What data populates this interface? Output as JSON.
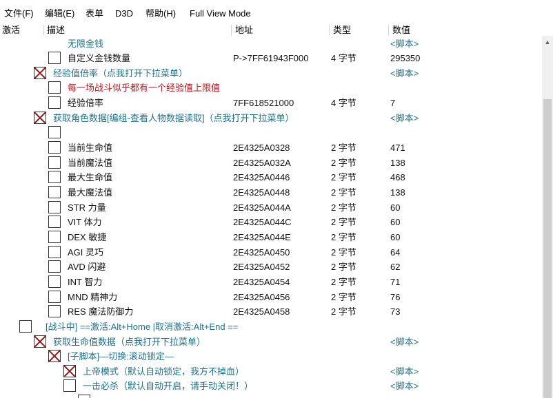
{
  "menu": [
    {
      "key": "file",
      "label": "文件(F)"
    },
    {
      "key": "edit",
      "label": "编辑(E)"
    },
    {
      "key": "table",
      "label": "表单"
    },
    {
      "key": "d3d",
      "label": "D3D"
    },
    {
      "key": "help",
      "label": "帮助(H)"
    },
    {
      "key": "fullview",
      "label": "Full View Mode"
    }
  ],
  "columns": {
    "active": "激活",
    "description": "描述",
    "address": "地址",
    "type": "类型",
    "value": "数值"
  },
  "rows": [
    {
      "checkbox": "none",
      "desc": "无限金钱",
      "address": "",
      "type": "",
      "value": "<脚本>",
      "desc_color": "teal",
      "value_color": "teal"
    },
    {
      "checkbox": "empty",
      "desc": "自定义金钱数量",
      "address": "P->7FF61943F000",
      "type": "4 字节",
      "value": "295350",
      "desc_color": "black",
      "value_color": "black"
    },
    {
      "checkbox": "x",
      "desc": "经验值倍率（点我打开下拉菜单）",
      "address": "",
      "type": "",
      "value": "<脚本>",
      "desc_color": "teal",
      "value_color": "teal"
    },
    {
      "checkbox": "empty",
      "desc": "每一场战斗似乎都有一个经验值上限值",
      "address": "",
      "type": "",
      "value": "",
      "desc_color": "red",
      "value_color": "black"
    },
    {
      "checkbox": "empty",
      "desc": "经验倍率",
      "address": "7FF618521000",
      "type": "4 字节",
      "value": "7",
      "desc_color": "black",
      "value_color": "black"
    },
    {
      "checkbox": "x",
      "desc": "获取角色数据[编组-查看人物数据读取]（点我打开下拉菜单）",
      "address": "",
      "type": "",
      "value": "<脚本>",
      "desc_color": "teal",
      "value_color": "teal"
    },
    {
      "checkbox": "empty",
      "desc": "",
      "address": "",
      "type": "",
      "value": "",
      "desc_color": "black",
      "value_color": "black"
    },
    {
      "checkbox": "empty",
      "desc": "当前生命值",
      "address": "2E4325A0328",
      "type": "2 字节",
      "value": "471",
      "desc_color": "black",
      "value_color": "black"
    },
    {
      "checkbox": "empty",
      "desc": "当前魔法值",
      "address": "2E4325A032A",
      "type": "2 字节",
      "value": "138",
      "desc_color": "black",
      "value_color": "black"
    },
    {
      "checkbox": "empty",
      "desc": "最大生命值",
      "address": "2E4325A0446",
      "type": "2 字节",
      "value": "468",
      "desc_color": "black",
      "value_color": "black"
    },
    {
      "checkbox": "empty",
      "desc": "最大魔法值",
      "address": "2E4325A0448",
      "type": "2 字节",
      "value": "138",
      "desc_color": "black",
      "value_color": "black"
    },
    {
      "checkbox": "empty",
      "desc": "STR 力量",
      "address": "2E4325A044A",
      "type": "2 字节",
      "value": "60",
      "desc_color": "black",
      "value_color": "black"
    },
    {
      "checkbox": "empty",
      "desc": "VIT  体力",
      "address": "2E4325A044C",
      "type": "2 字节",
      "value": "60",
      "desc_color": "black",
      "value_color": "black"
    },
    {
      "checkbox": "empty",
      "desc": "DEX 敏捷",
      "address": "2E4325A044E",
      "type": "2 字节",
      "value": "60",
      "desc_color": "black",
      "value_color": "black"
    },
    {
      "checkbox": "empty",
      "desc": "AGI 灵巧",
      "address": "2E4325A0450",
      "type": "2 字节",
      "value": "64",
      "desc_color": "black",
      "value_color": "black"
    },
    {
      "checkbox": "empty",
      "desc": "AVD 闪避",
      "address": "2E4325A0452",
      "type": "2 字节",
      "value": "62",
      "desc_color": "black",
      "value_color": "black"
    },
    {
      "checkbox": "empty",
      "desc": "INT 智力",
      "address": "2E4325A0454",
      "type": "2 字节",
      "value": "71",
      "desc_color": "black",
      "value_color": "black"
    },
    {
      "checkbox": "empty",
      "desc": "MND 精神力",
      "address": "2E4325A0456",
      "type": "2 字节",
      "value": "76",
      "desc_color": "black",
      "value_color": "black"
    },
    {
      "checkbox": "empty",
      "desc": "RES 魔法防御力",
      "address": "2E4325A0458",
      "type": "2 字节",
      "value": "73",
      "desc_color": "black",
      "value_color": "black"
    },
    {
      "checkbox": "empty",
      "desc": "[战斗中] ==激活:Alt+Home |取消激活:Alt+End ==",
      "address": "",
      "type": "",
      "value": "",
      "desc_color": "teal",
      "value_color": "black"
    },
    {
      "checkbox": "x",
      "desc": "获取生命值数据（点我打开下拉菜单）",
      "address": "",
      "type": "",
      "value": "<脚本>",
      "desc_color": "teal",
      "value_color": "teal"
    },
    {
      "checkbox": "x",
      "desc": "[子脚本]—切换:滚动锁定—",
      "address": "",
      "type": "",
      "value": "",
      "desc_color": "teal",
      "value_color": "black"
    },
    {
      "checkbox": "x",
      "desc": "上帝模式（默认自动锁定，我方不掉血）",
      "address": "",
      "type": "",
      "value": "<脚本>",
      "desc_color": "teal",
      "value_color": "teal"
    },
    {
      "checkbox": "empty",
      "desc": "一击必杀（默认自动开启，请手动关闭！）",
      "address": "",
      "type": "",
      "value": "<脚本>",
      "desc_color": "teal",
      "value_color": "teal"
    }
  ]
}
